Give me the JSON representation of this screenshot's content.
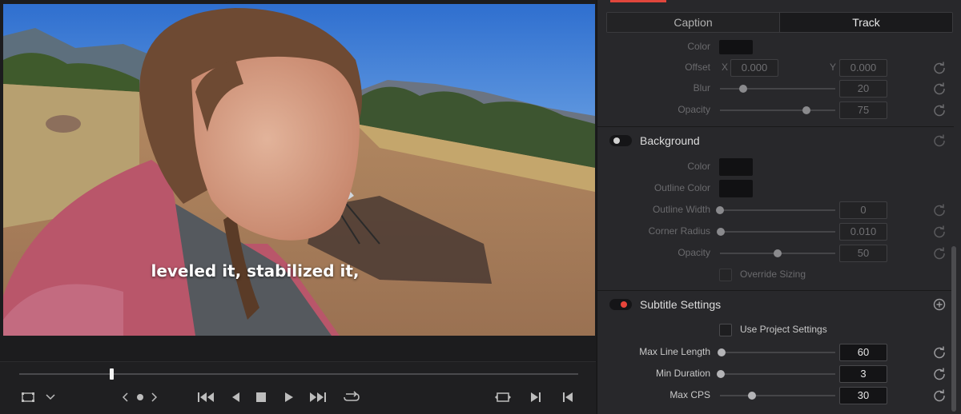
{
  "viewer": {
    "subtitle": "leveled it, stabilized it,",
    "scrub_position": 0.165,
    "icons": [
      "crop-icon",
      "chevron-down-icon",
      "prev-clip-icon",
      "marker-dot-icon",
      "next-clip-icon",
      "go-to-start-icon",
      "step-back-icon",
      "stop-icon",
      "play-icon",
      "go-to-end-icon",
      "loop-icon",
      "match-frame-icon",
      "next-edit-icon",
      "prev-edit-icon"
    ]
  },
  "inspector": {
    "tabs": {
      "caption": "Caption",
      "track": "Track",
      "active": "Track"
    },
    "shadow": {
      "color_label": "Color",
      "offset_label": "Offset",
      "offset_x_axis": "X",
      "offset_x": "0.000",
      "offset_y_axis": "Y",
      "offset_y": "0.000",
      "blur_label": "Blur",
      "blur_value": "20",
      "blur_fraction": 0.2,
      "opacity_label": "Opacity",
      "opacity_value": "75",
      "opacity_fraction": 0.75
    },
    "background": {
      "title": "Background",
      "enabled": false,
      "color_label": "Color",
      "outline_color_label": "Outline Color",
      "outline_width_label": "Outline Width",
      "outline_width_value": "0",
      "corner_radius_label": "Corner Radius",
      "corner_radius_value": "0.010",
      "opacity_label": "Opacity",
      "opacity_value": "50",
      "opacity_fraction": 0.5,
      "override_sizing_label": "Override Sizing"
    },
    "subtitle_settings": {
      "title": "Subtitle Settings",
      "enabled": true,
      "use_project_settings_label": "Use Project Settings",
      "max_line_length_label": "Max Line Length",
      "max_line_length_value": "60",
      "min_duration_label": "Min Duration",
      "min_duration_value": "3",
      "max_cps_label": "Max CPS",
      "max_cps_value": "30",
      "max_cps_fraction": 0.28
    },
    "colors": {
      "accent": "#e0463c",
      "toggle_on": "#e8453b"
    }
  }
}
